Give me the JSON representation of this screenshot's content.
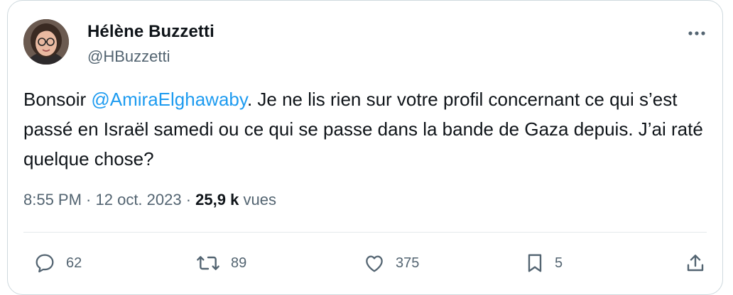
{
  "tweet": {
    "author_name": "Hélène Buzzetti",
    "author_handle": "@HBuzzetti",
    "text_before": "Bonsoir ",
    "mention": "@AmiraElghawaby",
    "text_after": ". Je ne lis rien sur votre profil concernant ce qui s’est passé en Israël samedi ou ce qui se passe dans la bande de Gaza depuis. J’ai raté quelque chose?",
    "time": "8:55 PM",
    "separator": " · ",
    "date": "12 oct. 2023",
    "views_count": "25,9 k",
    "views_label": "vues"
  },
  "actions": {
    "replies": "62",
    "retweets": "89",
    "likes": "375",
    "bookmarks": "5"
  },
  "icons": {
    "more": "more-horizontal-icon",
    "reply": "reply-icon",
    "retweet": "retweet-icon",
    "like": "heart-icon",
    "bookmark": "bookmark-icon",
    "share": "share-icon"
  },
  "colors": {
    "accent": "#1d9bf0",
    "text": "#0f1419",
    "secondary": "#536471",
    "border": "#cfd9de"
  }
}
